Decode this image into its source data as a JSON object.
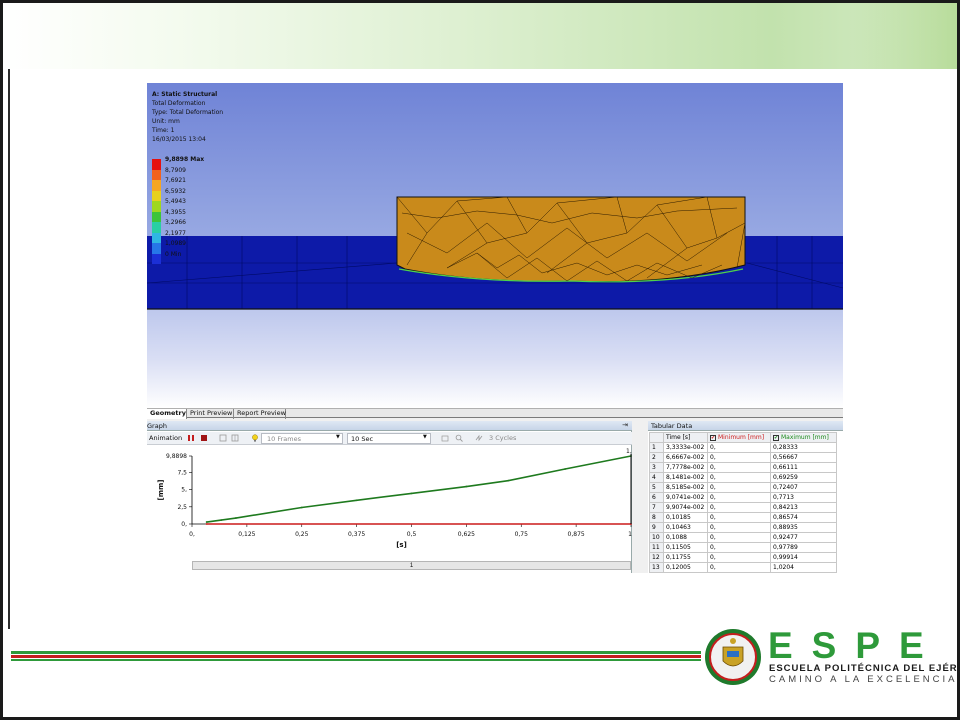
{
  "info": {
    "title": "A: Static Structural",
    "line2": "Total Deformation",
    "line3": "Type: Total Deformation",
    "line4": "Unit: mm",
    "line5": "Time: 1",
    "line6": "16/03/2015 13:04"
  },
  "legend": [
    {
      "value": "9,8898 Max",
      "color": "#e5100f"
    },
    {
      "value": "8,7909",
      "color": "#f2621d"
    },
    {
      "value": "7,6921",
      "color": "#f5a623"
    },
    {
      "value": "6,5932",
      "color": "#e8d01e"
    },
    {
      "value": "5,4943",
      "color": "#9fd720"
    },
    {
      "value": "4,3955",
      "color": "#3dc43a"
    },
    {
      "value": "3,2966",
      "color": "#29cfa3"
    },
    {
      "value": "2,1977",
      "color": "#2fb7e3"
    },
    {
      "value": "1,0989",
      "color": "#2677e8"
    },
    {
      "value": "0 Min",
      "color": "#1b2fd6"
    }
  ],
  "tabs": [
    "Geometry",
    "Print Preview",
    "Report Preview"
  ],
  "graph": {
    "title": "Graph",
    "pin": "⇥",
    "animation_label": "Animation",
    "frames": "10 Frames",
    "duration": "10 Sec",
    "cycles": "3 Cycles",
    "footer": "1"
  },
  "chart_data": {
    "type": "line",
    "xlabel": "[s]",
    "ylabel": "[mm]",
    "xlim": [
      0,
      1
    ],
    "ylim": [
      0,
      9.8898
    ],
    "x_ticks": [
      "0,",
      "0,125",
      "0,25",
      "0,375",
      "0,5",
      "0,625",
      "0,75",
      "0,875",
      "1,"
    ],
    "y_ticks": [
      "0,",
      "2,5",
      "5,",
      "7,5",
      "9,8898"
    ],
    "end_marker": "1,",
    "series": [
      {
        "name": "Maximum [mm]",
        "color": "#1e7a1e",
        "x": [
          0.033333,
          0.066667,
          0.1,
          0.25,
          0.375,
          0.5,
          0.625,
          0.72,
          0.85,
          1.0
        ],
        "values": [
          0.28333,
          0.56667,
          0.86574,
          2.4,
          3.45,
          4.45,
          5.45,
          6.3,
          8.0,
          9.8898
        ]
      },
      {
        "name": "Minimum [mm]",
        "color": "#cc1a1a",
        "x": [
          0.033333,
          1.0
        ],
        "values": [
          0,
          0
        ]
      }
    ]
  },
  "table": {
    "title": "Tabular Data",
    "headers": [
      "Time [s]",
      "Minimum [mm]",
      "Maximum [mm]"
    ],
    "rows": [
      [
        "1",
        "3,3333e-002",
        "0,",
        "0,28333"
      ],
      [
        "2",
        "6,6667e-002",
        "0,",
        "0,56667"
      ],
      [
        "3",
        "7,7778e-002",
        "0,",
        "0,66111"
      ],
      [
        "4",
        "8,1481e-002",
        "0,",
        "0,69259"
      ],
      [
        "5",
        "8,5185e-002",
        "0,",
        "0,72407"
      ],
      [
        "6",
        "9,0741e-002",
        "0,",
        "0,7713"
      ],
      [
        "7",
        "9,9074e-002",
        "0,",
        "0,84213"
      ],
      [
        "8",
        "0,10185",
        "0,",
        "0,86574"
      ],
      [
        "9",
        "0,10463",
        "0,",
        "0,88935"
      ],
      [
        "10",
        "0,1088",
        "0,",
        "0,92477"
      ],
      [
        "11",
        "0,11505",
        "0,",
        "0,97789"
      ],
      [
        "12",
        "0,11755",
        "0,",
        "0,99914"
      ],
      [
        "13",
        "0,12005",
        "0,",
        "1,0204"
      ]
    ]
  },
  "brand": {
    "letters": "ESPE",
    "line1": "ESCUELA POLITÉCNICA DEL EJÉRCITO",
    "line2": "CAMINO A LA EXCELENCIA"
  }
}
